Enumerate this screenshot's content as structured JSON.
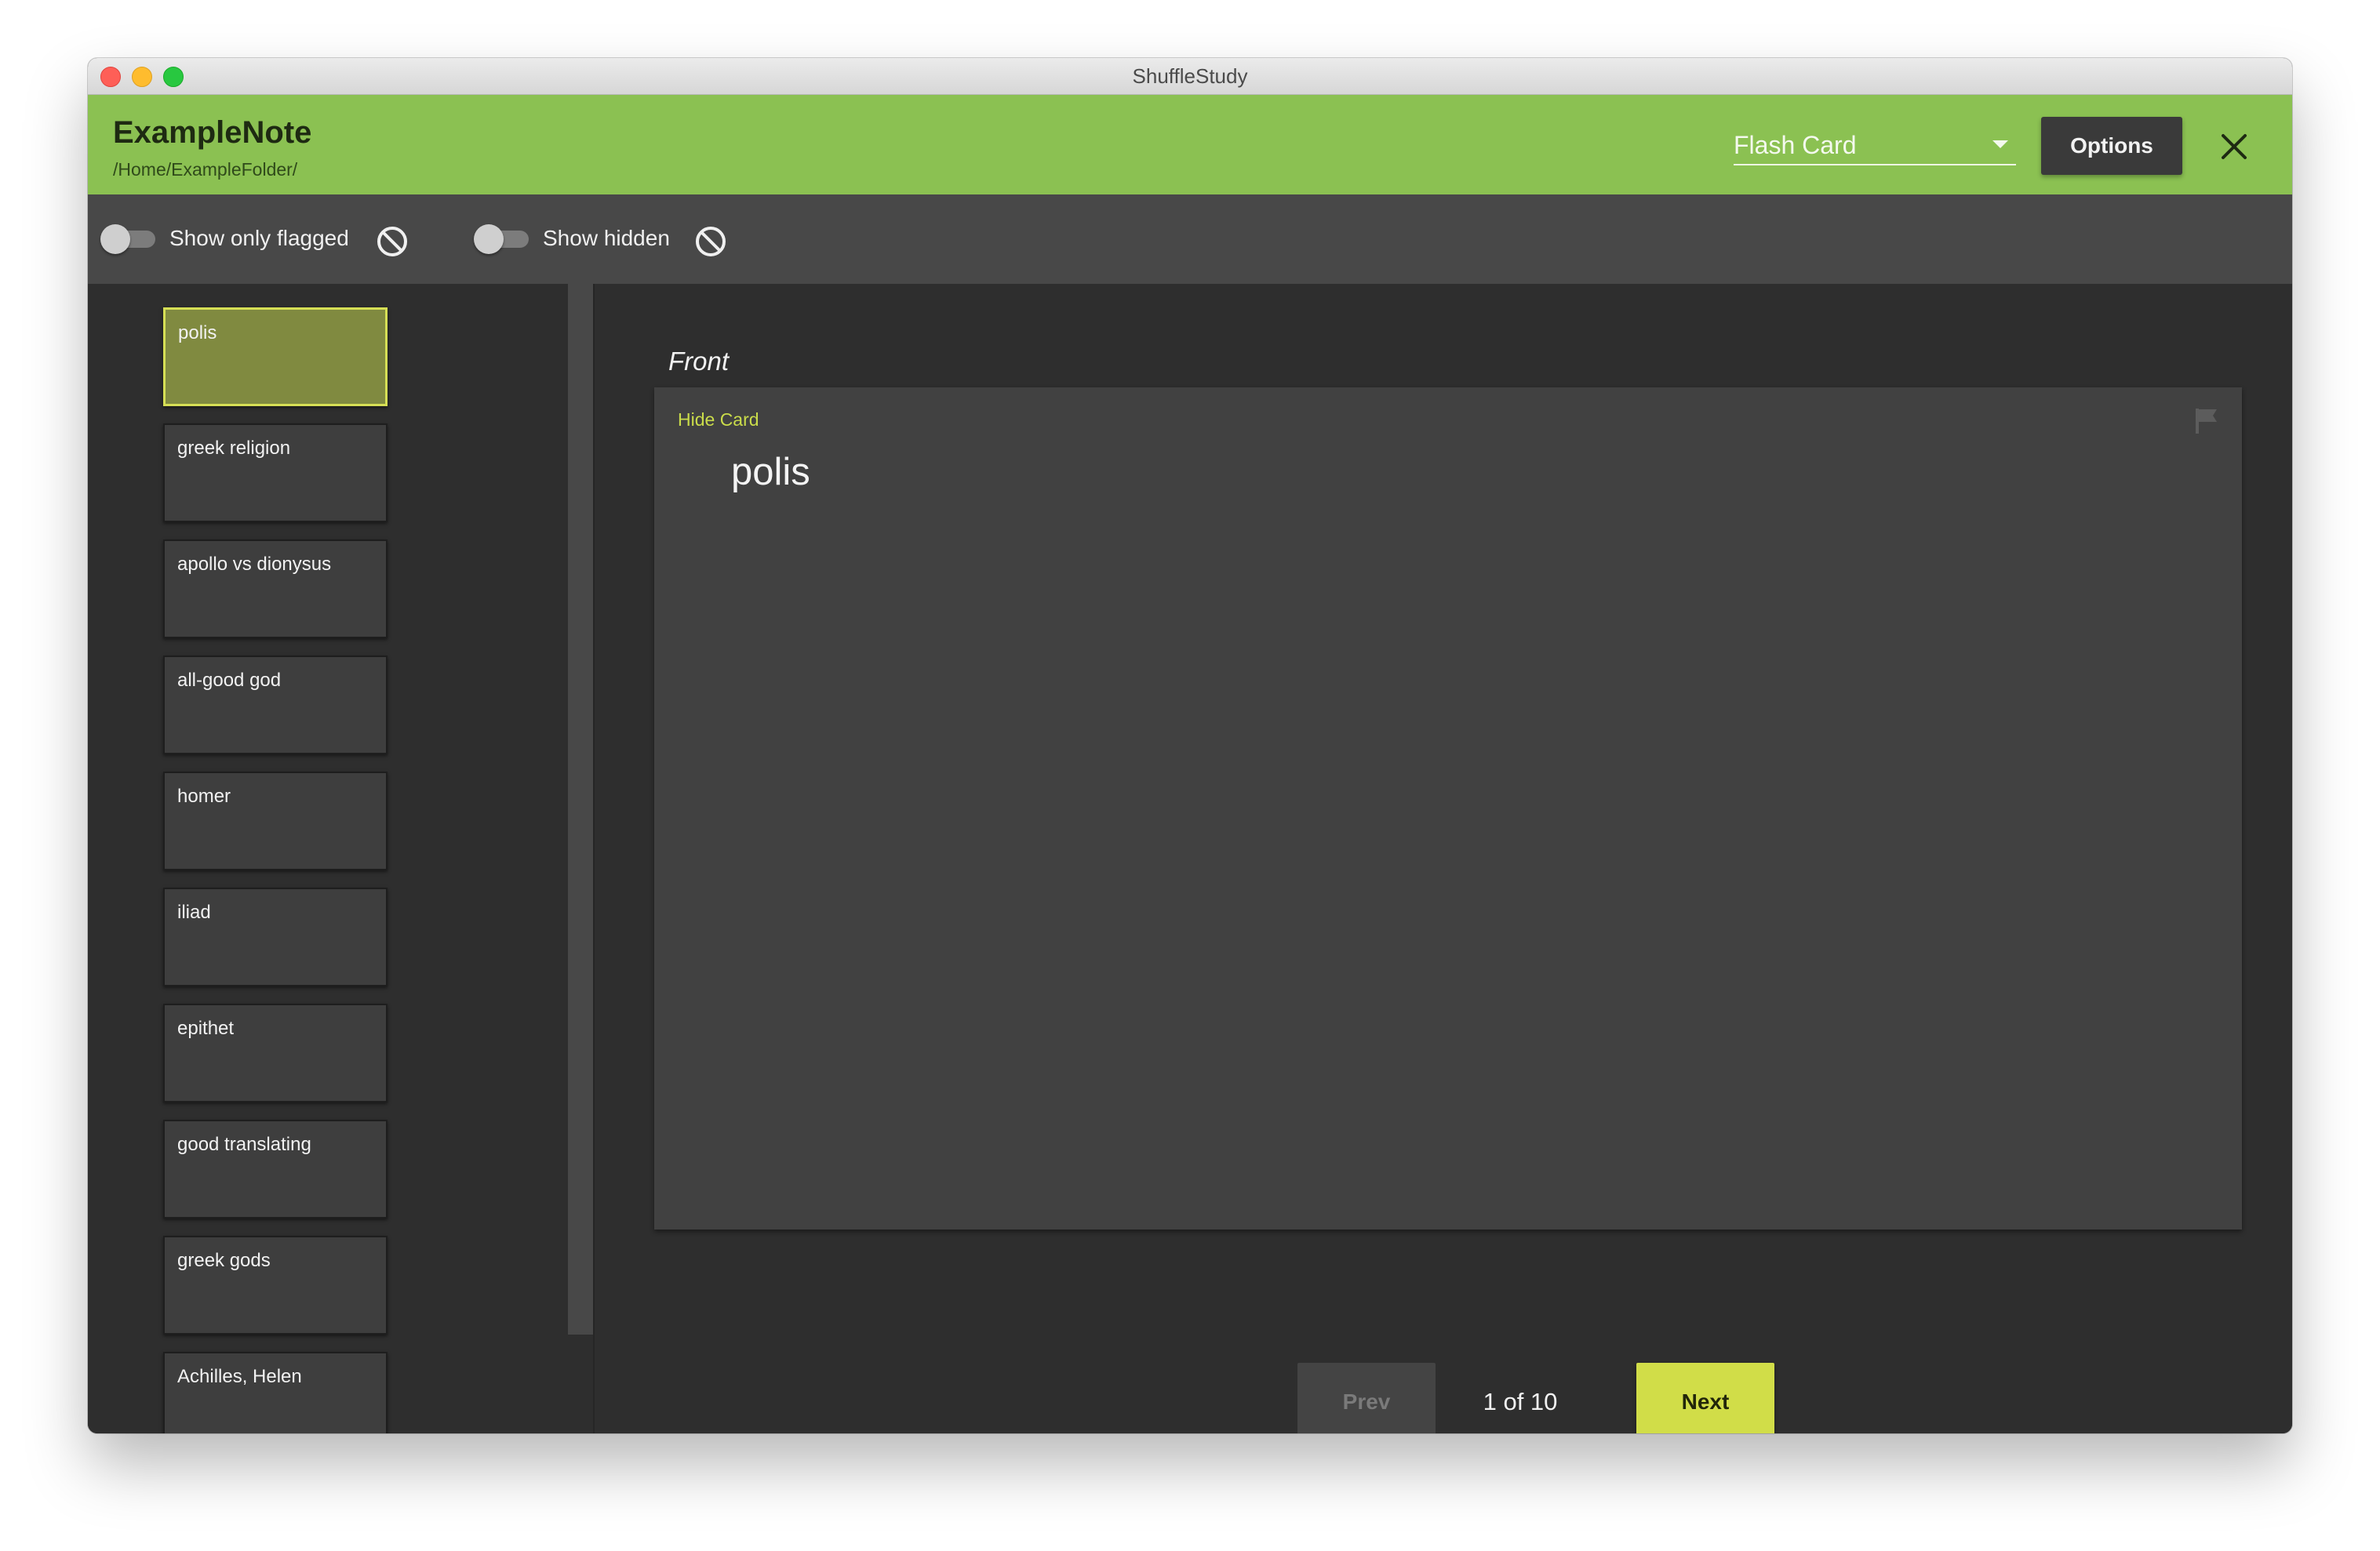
{
  "window": {
    "title": "ShuffleStudy"
  },
  "header": {
    "note_title": "ExampleNote",
    "note_path": "/Home/ExampleFolder/",
    "mode_selected": "Flash Card",
    "options_label": "Options",
    "close_icon": "close-icon"
  },
  "filters": {
    "flagged_label": "Show only flagged",
    "flagged_on": false,
    "hidden_label": "Show hidden",
    "hidden_on": false,
    "block_icon": "block-icon"
  },
  "cards": [
    {
      "label": "polis",
      "selected": true
    },
    {
      "label": "greek religion",
      "selected": false
    },
    {
      "label": "apollo vs dionysus",
      "selected": false
    },
    {
      "label": "all-good god",
      "selected": false
    },
    {
      "label": "homer",
      "selected": false
    },
    {
      "label": "iliad",
      "selected": false
    },
    {
      "label": "epithet",
      "selected": false
    },
    {
      "label": "good translating",
      "selected": false
    },
    {
      "label": "greek gods",
      "selected": false
    },
    {
      "label": "Achilles, Helen",
      "selected": false
    }
  ],
  "main": {
    "side_label": "Front",
    "hide_card_label": "Hide Card",
    "card_text": "polis",
    "flag_icon": "flag-icon"
  },
  "pager": {
    "prev_label": "Prev",
    "next_label": "Next",
    "page_text": "1 of 10"
  },
  "colors": {
    "header_green": "#8bc152",
    "accent_yellow": "#d1dd48",
    "selected_card": "#808a40",
    "background": "#2e2e2e"
  }
}
